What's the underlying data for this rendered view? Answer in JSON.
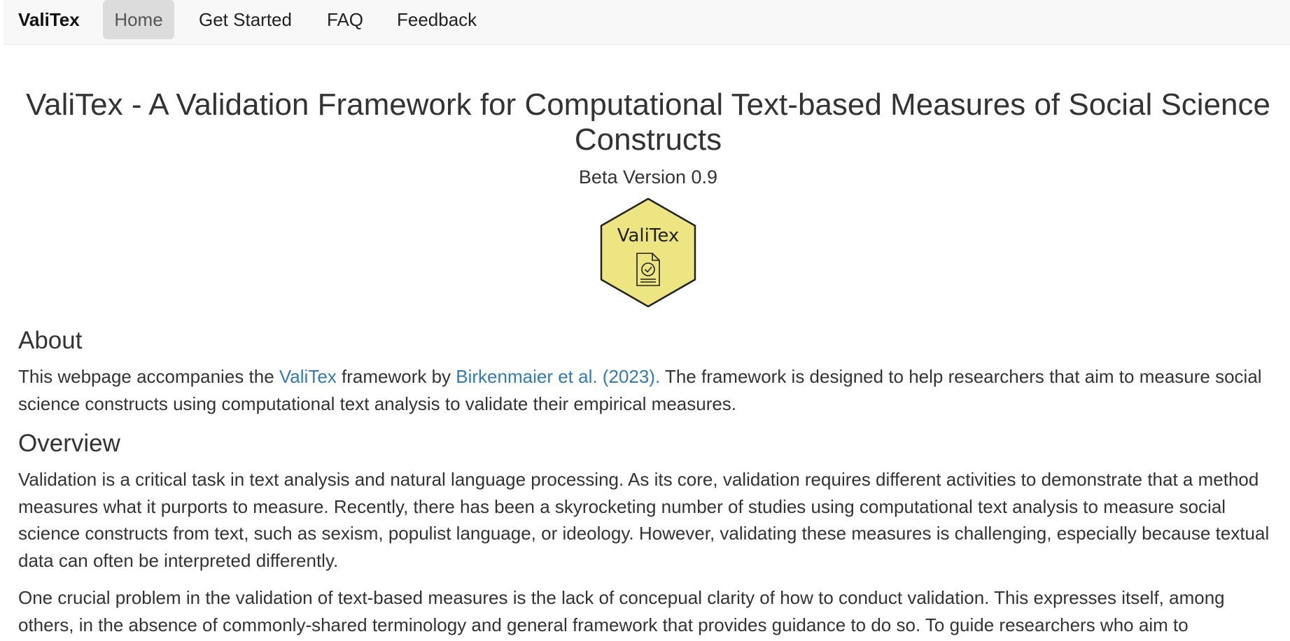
{
  "nav": {
    "brand": "ValiTex",
    "items": [
      {
        "label": "Home",
        "active": true
      },
      {
        "label": "Get Started",
        "active": false
      },
      {
        "label": "FAQ",
        "active": false
      },
      {
        "label": "Feedback",
        "active": false
      }
    ]
  },
  "header": {
    "title": "ValiTex - A Validation Framework for Computational Text-based Measures of Social Science Constructs",
    "version": "Beta Version 0.9"
  },
  "logo": {
    "text": "ValiTex",
    "icon": "document-check-icon",
    "fill_color": "#ede581",
    "stroke_color": "#222222"
  },
  "about": {
    "heading": "About",
    "text_1": "This webpage accompanies the ",
    "link_1": "ValiTex",
    "text_2": " framework by ",
    "link_2": "Birkenmaier et al. (2023).",
    "text_3": " The framework is designed to help researchers that aim to measure social science constructs using computational text analysis to validate their empirical measures."
  },
  "overview": {
    "heading": "Overview",
    "paragraph_1": "Validation is a critical task in text analysis and natural language processing. As its core, validation requires different activities to demonstrate that a method measures what it purports to measure. Recently, there has been a skyrocketing number of studies using computational text analysis to measure social science constructs from text, such as sexism, populist language, or ideology. However, validating these measures is challenging, especially because textual data can often be interpreted differently.",
    "paragraph_2": "One crucial problem in the validation of text-based measures is the lack of concepual clarity of how to conduct validation. This expresses itself, among others, in the absence of commonly-shared terminology and general framework that provides guidance to do so. To guide researchers who aim to"
  },
  "colors": {
    "link": "#337ab7",
    "navbar_bg": "#f8f8f8",
    "active_tab_bg": "#dcdcdc",
    "text": "#333333"
  }
}
